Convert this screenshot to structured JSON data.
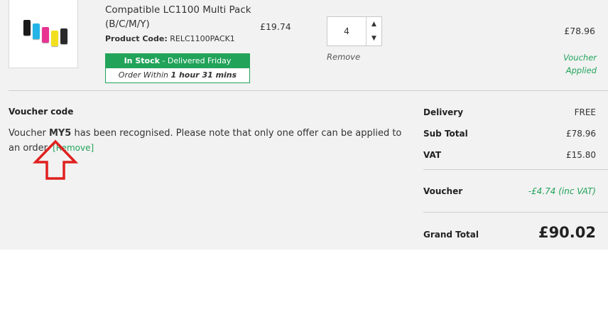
{
  "product": {
    "name": "Compatible LC1100 Multi Pack (B/C/M/Y)",
    "code_label": "Product Code:",
    "code_value": "RELC1100PACK1",
    "stock_status": "In Stock",
    "delivery_text": "- Delivered Friday",
    "order_within_label": "Order Within",
    "order_within_time": "1 hour 31 mins",
    "unit_price": "£19.74",
    "quantity": "4",
    "remove_label": "Remove",
    "line_total": "£78.96",
    "voucher_applied": "Voucher Applied"
  },
  "voucher": {
    "heading": "Voucher code",
    "msg_prefix": "Voucher",
    "code": "MY5",
    "msg_suffix": "has been recognised. Please note that only one offer can be applied to an order.",
    "remove_link": "[Remove]"
  },
  "totals": {
    "delivery_label": "Delivery",
    "delivery_value": "FREE",
    "subtotal_label": "Sub Total",
    "subtotal_value": "£78.96",
    "vat_label": "VAT",
    "vat_value": "£15.80",
    "voucher_label": "Voucher",
    "voucher_value": "-£4.74 (inc VAT)",
    "grand_label": "Grand Total",
    "grand_value": "£90.02"
  },
  "icons": {
    "qty_up": "triangle-up",
    "qty_down": "triangle-down",
    "annotation": "red-up-arrow"
  },
  "colors": {
    "accent_green": "#21a35a",
    "annotation_red": "#e02020",
    "panel_bg": "#f2f2f2"
  }
}
